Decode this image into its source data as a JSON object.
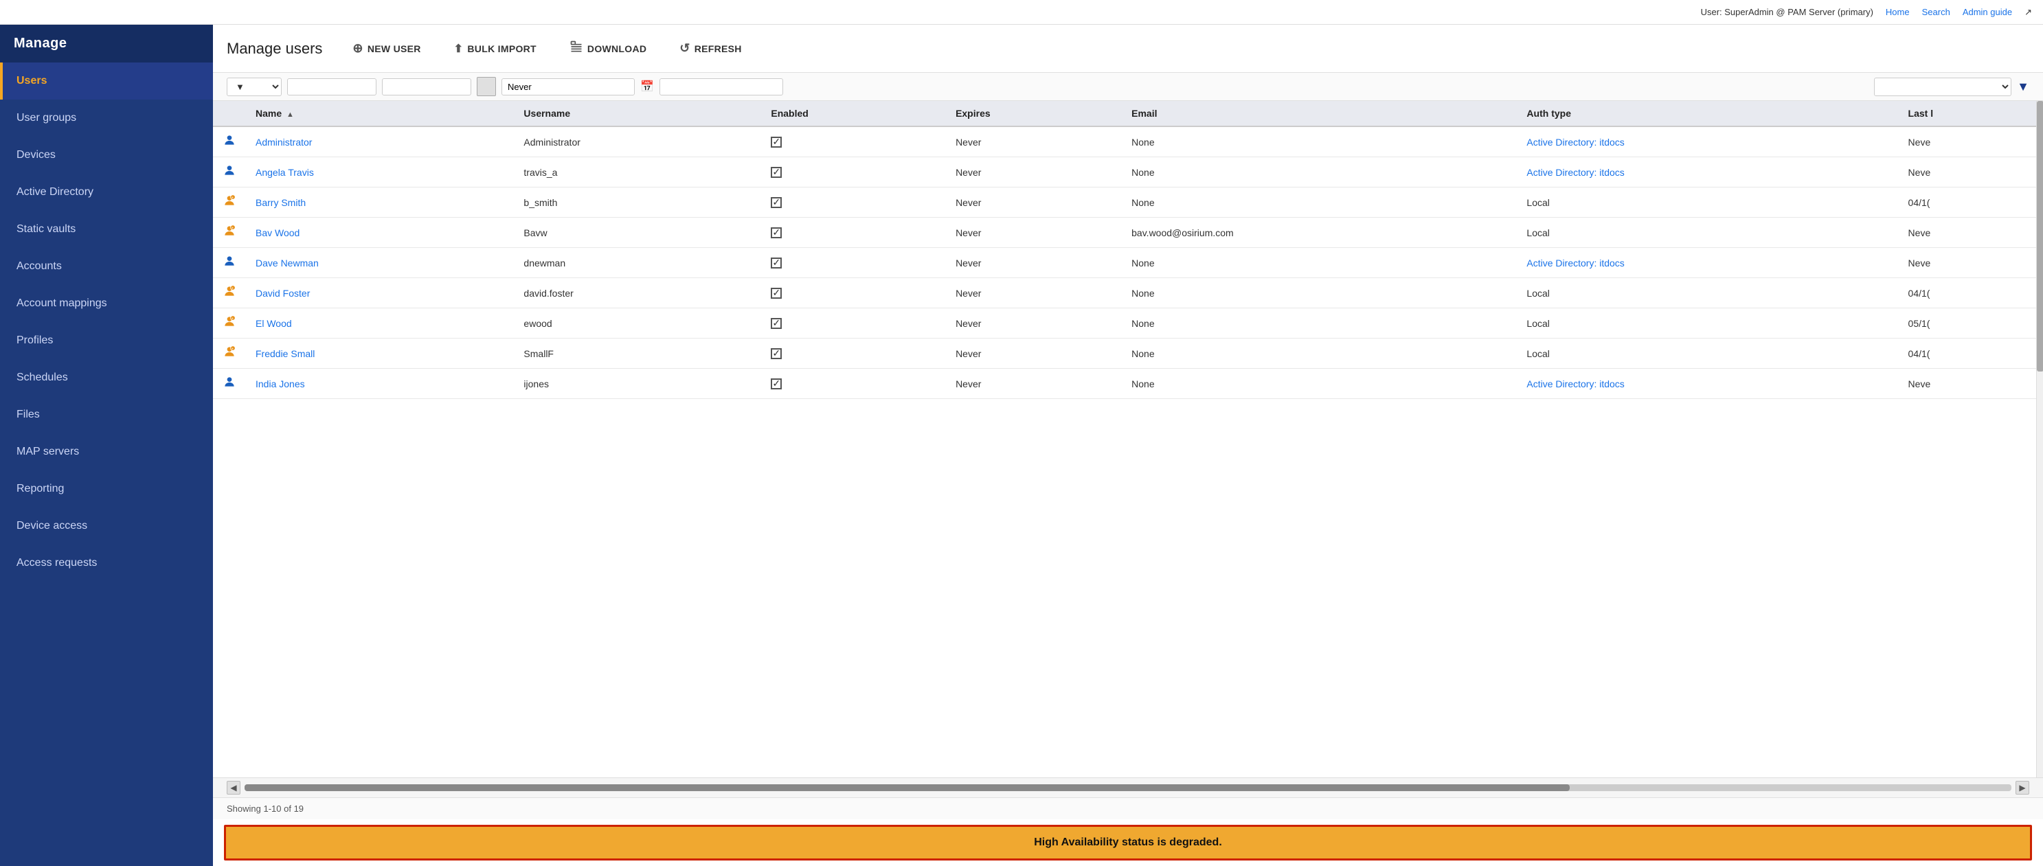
{
  "topbar": {
    "user_info": "User: SuperAdmin @ PAM Server (primary)",
    "home": "Home",
    "search": "Search",
    "admin_guide": "Admin guide"
  },
  "sidebar": {
    "header": "Manage",
    "items": [
      {
        "id": "users",
        "label": "Users",
        "active": true
      },
      {
        "id": "user-groups",
        "label": "User groups",
        "active": false
      },
      {
        "id": "devices",
        "label": "Devices",
        "active": false
      },
      {
        "id": "active-directory",
        "label": "Active Directory",
        "active": false
      },
      {
        "id": "static-vaults",
        "label": "Static vaults",
        "active": false
      },
      {
        "id": "accounts",
        "label": "Accounts",
        "active": false
      },
      {
        "id": "account-mappings",
        "label": "Account mappings",
        "active": false
      },
      {
        "id": "profiles",
        "label": "Profiles",
        "active": false
      },
      {
        "id": "schedules",
        "label": "Schedules",
        "active": false
      },
      {
        "id": "files",
        "label": "Files",
        "active": false
      },
      {
        "id": "map-servers",
        "label": "MAP servers",
        "active": false
      },
      {
        "id": "reporting",
        "label": "Reporting",
        "active": false
      },
      {
        "id": "device-access",
        "label": "Device access",
        "active": false
      },
      {
        "id": "access-requests",
        "label": "Access requests",
        "active": false
      }
    ]
  },
  "page": {
    "title": "Manage users",
    "toolbar": {
      "new_user": "NEW USER",
      "bulk_import": "BULK IMPORT",
      "download": "DOWNLOAD",
      "refresh": "REFRESH"
    }
  },
  "filter": {
    "placeholder_name": "",
    "placeholder_username": "",
    "expires_value": "Never",
    "placeholder_email": "",
    "placeholder_authtype": ""
  },
  "table": {
    "columns": [
      "",
      "Name",
      "Username",
      "Enabled",
      "Expires",
      "Email",
      "Auth type",
      "Last l"
    ],
    "rows": [
      {
        "icon_type": "blue",
        "name": "Administrator",
        "username": "Administrator",
        "enabled": true,
        "expires": "Never",
        "email": "None",
        "auth_type": "Active Directory: itdocs",
        "auth_is_link": true,
        "last_login": "Neve"
      },
      {
        "icon_type": "blue",
        "name": "Angela Travis",
        "username": "travis_a",
        "enabled": true,
        "expires": "Never",
        "email": "None",
        "auth_type": "Active Directory: itdocs",
        "auth_is_link": true,
        "last_login": "Neve"
      },
      {
        "icon_type": "orange",
        "name": "Barry Smith",
        "username": "b_smith",
        "enabled": true,
        "expires": "Never",
        "email": "None",
        "auth_type": "Local",
        "auth_is_link": false,
        "last_login": "04/1("
      },
      {
        "icon_type": "orange",
        "name": "Bav Wood",
        "username": "Bavw",
        "enabled": true,
        "expires": "Never",
        "email": "bav.wood@osirium.com",
        "auth_type": "Local",
        "auth_is_link": false,
        "last_login": "Neve"
      },
      {
        "icon_type": "blue",
        "name": "Dave Newman",
        "username": "dnewman",
        "enabled": true,
        "expires": "Never",
        "email": "None",
        "auth_type": "Active Directory: itdocs",
        "auth_is_link": true,
        "last_login": "Neve"
      },
      {
        "icon_type": "orange",
        "name": "David Foster",
        "username": "david.foster",
        "enabled": true,
        "expires": "Never",
        "email": "None",
        "auth_type": "Local",
        "auth_is_link": false,
        "last_login": "04/1("
      },
      {
        "icon_type": "orange",
        "name": "El Wood",
        "username": "ewood",
        "enabled": true,
        "expires": "Never",
        "email": "None",
        "auth_type": "Local",
        "auth_is_link": false,
        "last_login": "05/1("
      },
      {
        "icon_type": "orange",
        "name": "Freddie Small",
        "username": "SmallF",
        "enabled": true,
        "expires": "Never",
        "email": "None",
        "auth_type": "Local",
        "auth_is_link": false,
        "last_login": "04/1("
      },
      {
        "icon_type": "blue",
        "name": "India Jones",
        "username": "ijones",
        "enabled": true,
        "expires": "Never",
        "email": "None",
        "auth_type": "Active Directory: itdocs",
        "auth_is_link": true,
        "last_login": "Neve"
      }
    ],
    "showing": "Showing 1-10 of 19"
  },
  "status_bar": {
    "message": "High Availability status is degraded."
  },
  "icons": {
    "new_user": "⊕",
    "bulk_import": "⬆",
    "download": "⬇",
    "refresh": "↺",
    "calendar": "📅",
    "funnel": "▼",
    "scroll_left": "◀",
    "scroll_right": "▶",
    "user_blue": "👤",
    "user_orange": "👤"
  }
}
